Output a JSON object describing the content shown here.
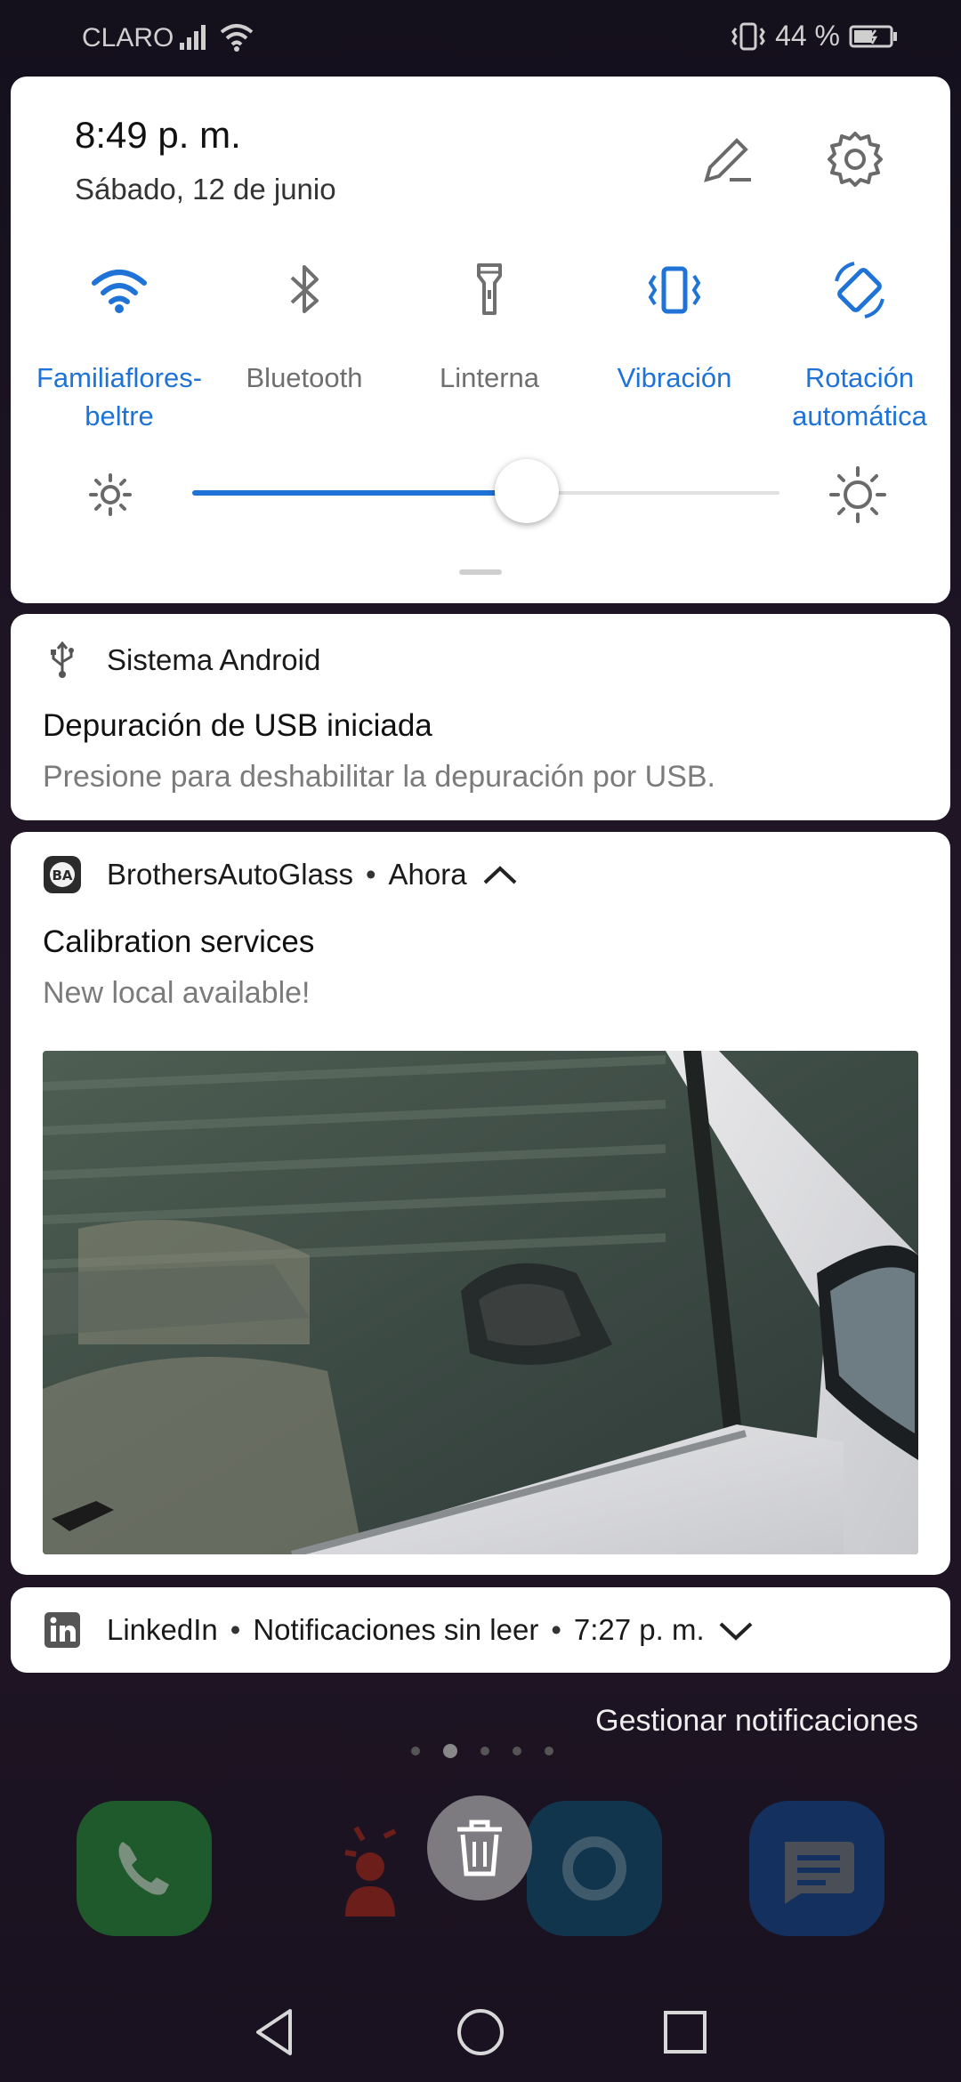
{
  "status_bar": {
    "carrier": "CLARO",
    "battery_text": "44 %"
  },
  "quick_settings": {
    "time": "8:49 p. m.",
    "date": "Sábado, 12 de junio",
    "tiles": [
      {
        "label_line1": "Familiaflores-",
        "label_line2": "beltre",
        "state": "on",
        "icon": "wifi-icon"
      },
      {
        "label_line1": "Bluetooth",
        "label_line2": "",
        "state": "off",
        "icon": "bluetooth-icon"
      },
      {
        "label_line1": "Linterna",
        "label_line2": "",
        "state": "off",
        "icon": "flashlight-icon"
      },
      {
        "label_line1": "Vibración",
        "label_line2": "",
        "state": "on",
        "icon": "vibration-icon"
      },
      {
        "label_line1": "Rotación",
        "label_line2": "automática",
        "state": "on",
        "icon": "auto-rotate-icon"
      }
    ],
    "brightness_level": 0.57,
    "accent_color": "#1f73d6"
  },
  "notifications": [
    {
      "app": "Sistema Android",
      "icon": "usb-icon",
      "title": "Depuración de USB iniciada",
      "text": "Presione para deshabilitar la depuración por USB."
    },
    {
      "app": "BrothersAutoGlass",
      "time": "Ahora",
      "icon": "brothers-autoglass-icon",
      "title": "Calibration services",
      "text": "New local available!",
      "image": "car-window-photo"
    },
    {
      "app": "LinkedIn",
      "subtitle": "Notificaciones sin leer",
      "time": "7:27 p. m.",
      "icon": "linkedin-icon"
    }
  ],
  "manage_label": "Gestionar notificaciones"
}
